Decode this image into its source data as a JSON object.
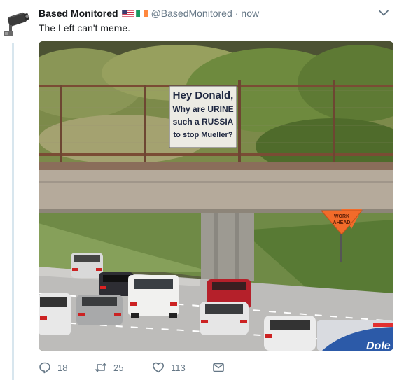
{
  "tweet": {
    "display_name": "Based Monitored",
    "handle": "@BasedMonitored",
    "separator": "·",
    "timestamp": "now",
    "flags": [
      "us-flag",
      "ireland-flag"
    ],
    "text": "The Left can't meme."
  },
  "media": {
    "sign_lines": [
      "Hey Donald,",
      "Why are URINE",
      "such a RUSSIA",
      "to stop Mueller?"
    ],
    "road_sign_lines": [
      "WORK",
      "AHEAD"
    ],
    "truck_text": "Dole"
  },
  "actions": {
    "reply_count": "18",
    "retweet_count": "25",
    "like_count": "113"
  },
  "colors": {
    "name": "#14171a",
    "secondary": "#657786",
    "thread_line": "#d8e6ee",
    "road_sign": "#f26b2a"
  },
  "icons": [
    "avatar-camera-icon",
    "chevron-down-icon",
    "reply-icon",
    "retweet-icon",
    "like-icon",
    "message-icon"
  ]
}
